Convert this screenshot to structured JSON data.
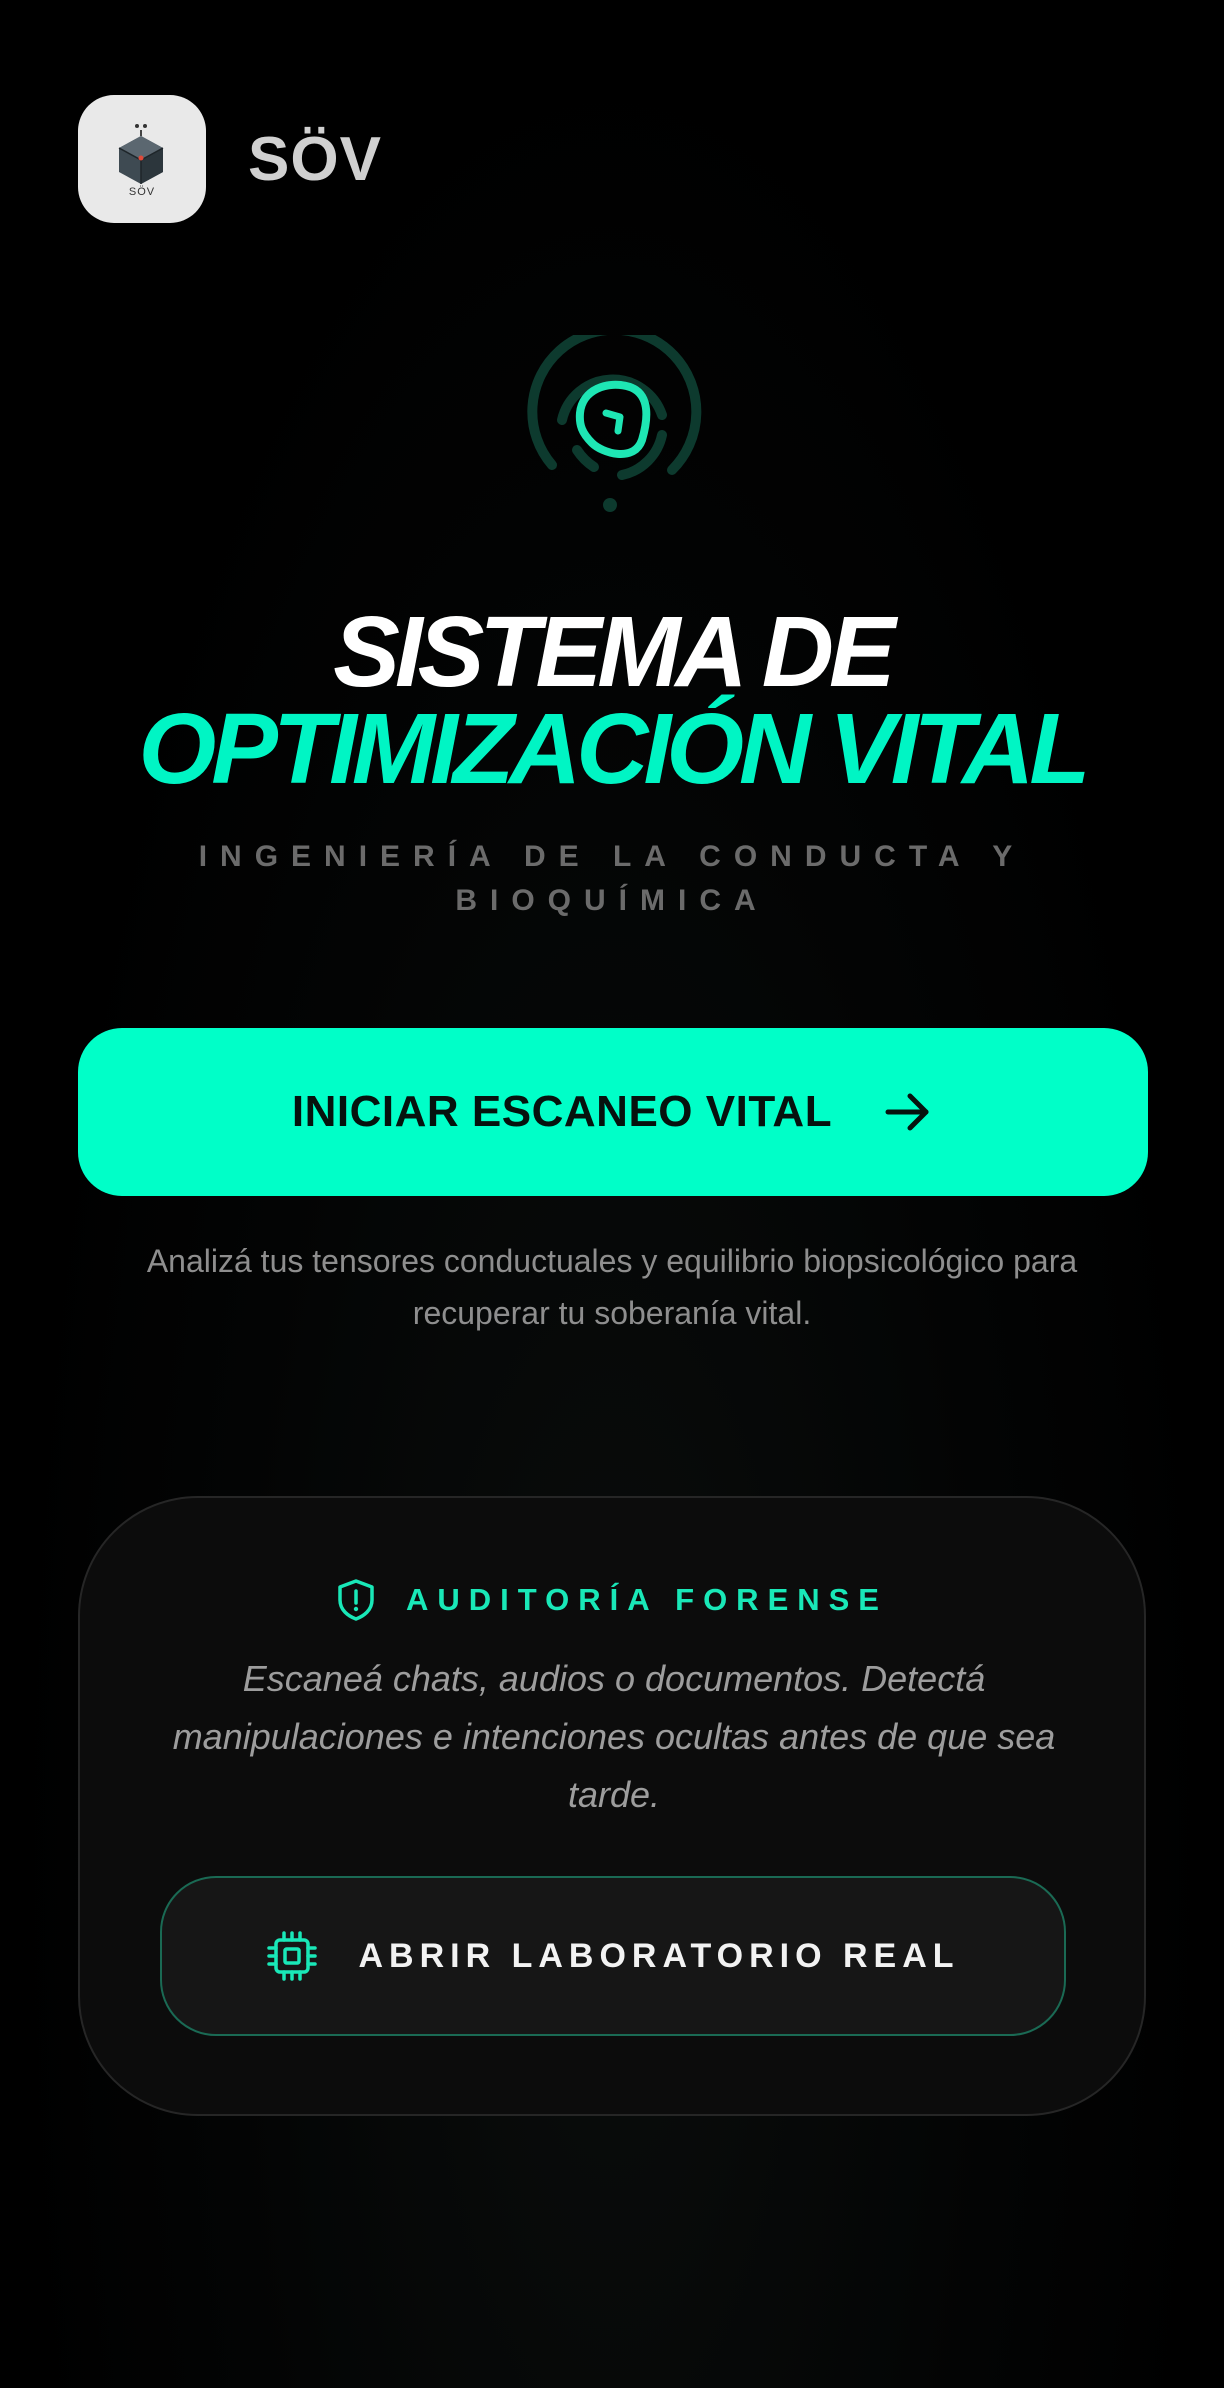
{
  "brand": {
    "name": "SÖV",
    "logo_caption": "SÖV",
    "logo_icon": "cube-logo-icon"
  },
  "hero": {
    "icon": "fingerprint-scan-icon",
    "title_line1": "SISTEMA DE",
    "title_line2": "OPTIMIZACIÓN VITAL",
    "subtitle": "INGENIERÍA DE LA CONDUCTA Y BIOQUÍMICA"
  },
  "cta": {
    "label": "INICIAR ESCANEO VITAL",
    "icon": "arrow-right-icon",
    "caption": "Analizá tus tensores conductuales y equilibrio biopsicológico para recuperar tu soberanía vital."
  },
  "audit_card": {
    "icon": "shield-alert-icon",
    "heading": "AUDITORÍA FORENSE",
    "description": "Escaneá chats, audios o documentos. Detectá manipulaciones e intenciones ocultas antes de que sea tarde.",
    "button_label": "ABRIR LABORATORIO REAL",
    "button_icon": "chip-icon"
  },
  "colors": {
    "accent": "#00ffc8",
    "accent_text": "#19e8b8",
    "background": "#000000",
    "card_bg": "#0c0c0c",
    "muted_text": "#8e8e8e"
  }
}
